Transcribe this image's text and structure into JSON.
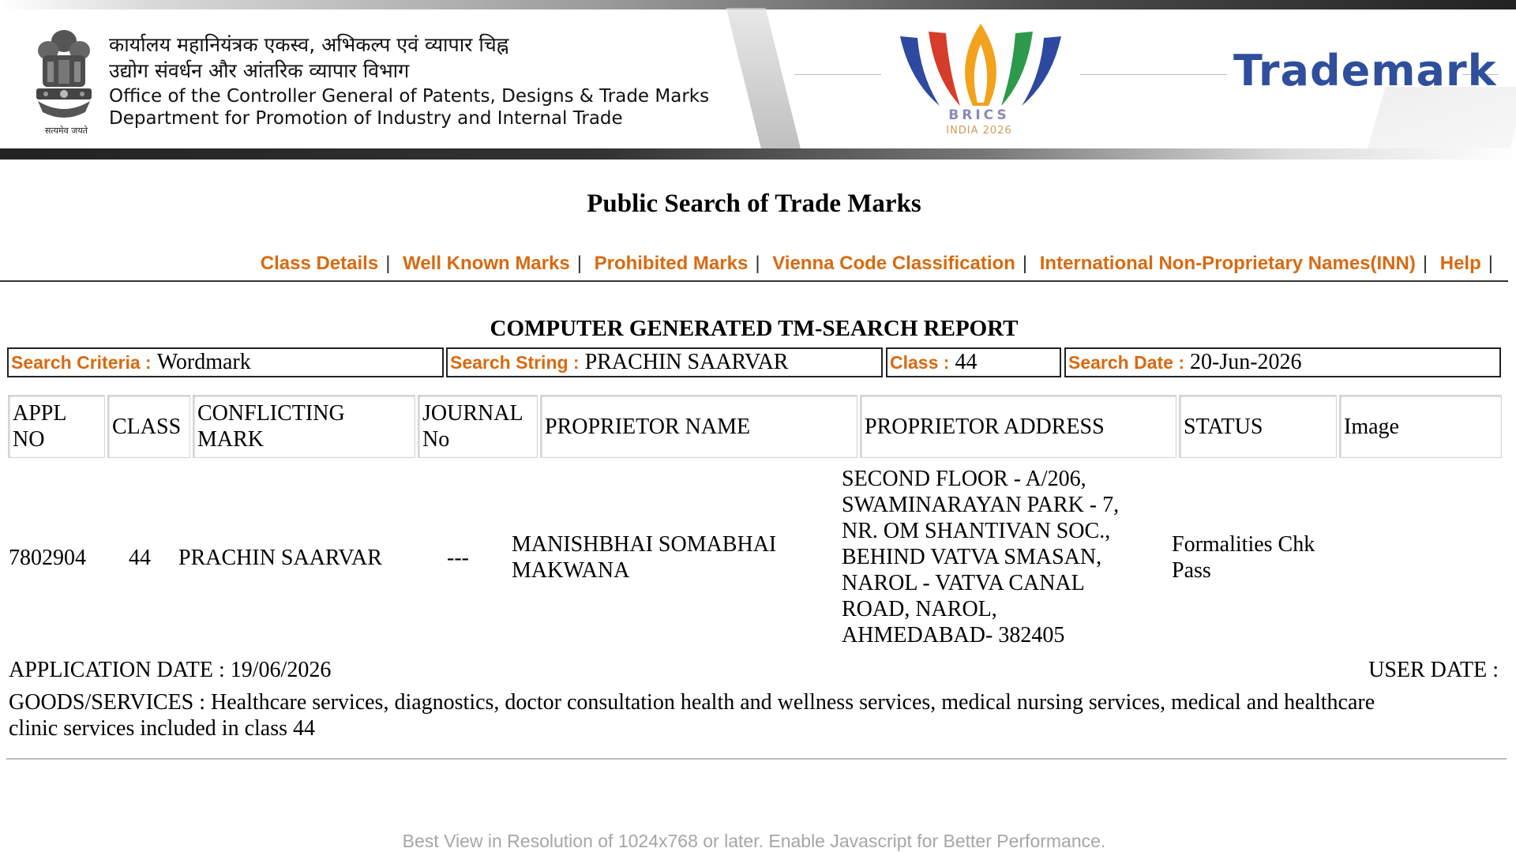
{
  "header": {
    "office_hindi_line1": "कार्यालय महानियंत्रक एकस्व, अभिकल्प एवं व्यापार चिह्न",
    "office_hindi_line2": "उद्योग संवर्धन और आंतरिक व्यापार विभाग",
    "office_english_line1": "Office of the Controller General of Patents, Designs & Trade Marks",
    "office_english_line2": "Department for Promotion of Industry and Internal Trade",
    "emblem_caption": "सत्यमेव जयते",
    "brics_text": "BRICS",
    "brics_subtext": "INDIA 2026",
    "trademark_title": "Trademark"
  },
  "page": {
    "title": "Public Search of Trade Marks",
    "footer_note": "Best View in Resolution of 1024x768 or later. Enable Javascript for Better Performance."
  },
  "nav": {
    "separator": "|",
    "links": [
      "Class Details",
      "Well Known Marks",
      "Prohibited Marks",
      "Vienna Code Classification",
      "International Non-Proprietary Names(INN)",
      "Help"
    ]
  },
  "report": {
    "title": "COMPUTER GENERATED TM-SEARCH REPORT",
    "criteria": [
      {
        "label": "Search Criteria :",
        "value": "Wordmark"
      },
      {
        "label": "Search String :",
        "value": "PRACHIN SAARVAR"
      },
      {
        "label": "Class :",
        "value": "44"
      },
      {
        "label": "Search Date :",
        "value": "20-Jun-2026"
      }
    ],
    "columns": [
      [
        "APPL",
        "NO"
      ],
      [
        "CLASS"
      ],
      [
        "CONFLICTING",
        "MARK"
      ],
      [
        "JOURNAL",
        "No"
      ],
      [
        "PROPRIETOR NAME"
      ],
      [
        "PROPRIETOR ADDRESS"
      ],
      [
        "STATUS"
      ],
      [
        "Image"
      ]
    ],
    "record": {
      "appl_no": "7802904",
      "class": "44",
      "mark": "PRACHIN SAARVAR",
      "journal_no": "---",
      "proprietor_name": [
        "MANISHBHAI SOMABHAI",
        "MAKWANA"
      ],
      "proprietor_address": [
        "SECOND FLOOR - A/206,",
        "SWAMINARAYAN PARK - 7,",
        "NR. OM SHANTIVAN SOC.,",
        "BEHIND VATVA SMASAN,",
        "NAROL - VATVA CANAL",
        "ROAD, NAROL,",
        "AHMEDABAD- 382405"
      ],
      "status": [
        "Formalities Chk",
        "Pass"
      ],
      "application_date": "APPLICATION DATE : 19/06/2026",
      "user_date": "USER DATE :",
      "goods_services": [
        "GOODS/SERVICES : Healthcare services, diagnostics, doctor consultation health and wellness services, medical nursing services, medical and healthcare",
        "clinic services included in class 44"
      ]
    }
  },
  "colors": {
    "link_orange": "#d86a10",
    "trademark_blue": "#2f4f9d"
  }
}
